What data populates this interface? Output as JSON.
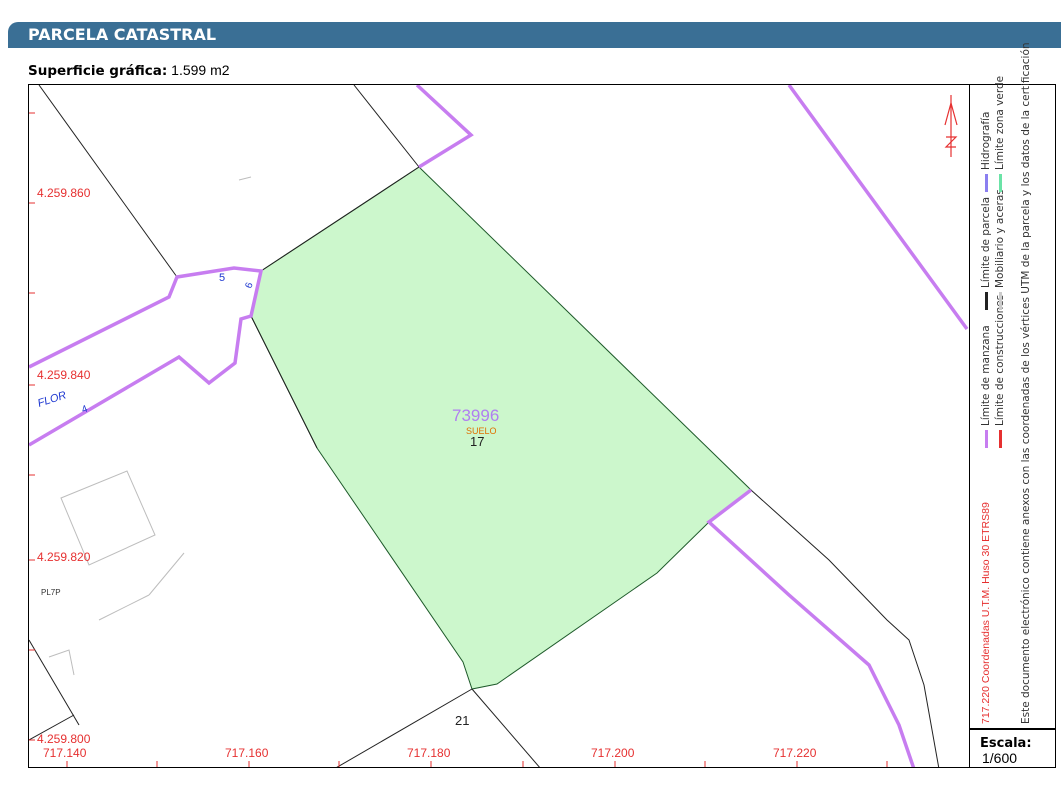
{
  "header": {
    "title": "PARCELA CATASTRAL"
  },
  "surface": {
    "label": "Superficie gráfica:",
    "value": "1.599 m2"
  },
  "map": {
    "parcel_ref": "73996",
    "parcel_use": "SUELO",
    "parcel_number": "17",
    "neighbor_parcel": "21",
    "street_name": "FLOR",
    "street_numbers": [
      "5",
      "6",
      "4"
    ],
    "annotation": "PL7P",
    "y_ticks": [
      "4.259.860",
      "4.259.840",
      "4.259.820",
      "4.259.800"
    ],
    "x_ticks": [
      "717.140",
      "717.160",
      "717.180",
      "717.200",
      "717.220"
    ],
    "north_arrow": "north-arrow-icon"
  },
  "legend": {
    "coords_title": "717.220 Coordenadas U.T.M. Huso 30 ETRS89",
    "items": [
      {
        "label": "Límite de manzana",
        "color": "#c77df0"
      },
      {
        "label": "Límite de construcciones",
        "color": "#e63030"
      },
      {
        "label": "Límite de parcela",
        "color": "#222222"
      },
      {
        "label": "Mobiliario y aceras",
        "color": "#cccccc"
      },
      {
        "label": "Hidrografía",
        "color": "#8b7ff0"
      },
      {
        "label": "Límite zona verde",
        "color": "#6be3a7"
      }
    ],
    "note": "Este documento electrónico contiene anexos con las coordenadas de los vértices UTM de la parcela y los datos de la certificación"
  },
  "scale": {
    "label": "Escala:",
    "value": "1/600"
  },
  "colors": {
    "header_bg": "#3a6f95",
    "parcel_fill": "#ccf7cc",
    "block_line": "#c77df0",
    "coord_red": "#e63030"
  }
}
